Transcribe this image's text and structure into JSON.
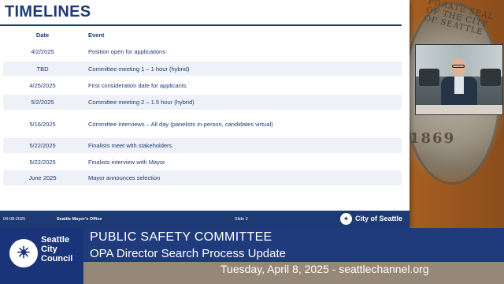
{
  "slide": {
    "title": "TIMELINES",
    "table": {
      "headers": [
        "Date",
        "Event"
      ],
      "rows": [
        {
          "date": "4/2/2025",
          "event": "Position open for applications"
        },
        {
          "date": "TBD",
          "event": "Committee meeting 1 – 1 hour (hybrid)"
        },
        {
          "date": "4/25/2025",
          "event": "First consideration date for applicants"
        },
        {
          "date": "5/2/2025",
          "event": "Committee meeting 2 – 1.5 hour (hybrid)"
        },
        {
          "date": "5/16/2025",
          "event": "Committee interviews – All day (panelists in-person, candidates virtual)"
        },
        {
          "date": "5/22/2025",
          "event": "Finalists meet with stakeholders"
        },
        {
          "date": "5/22/2025",
          "event": "Finalists interview with Mayor"
        },
        {
          "date": "June 2025",
          "event": "Mayor announces selection"
        }
      ]
    },
    "footer": {
      "date": "04-08-2025",
      "office": "Seattle Mayor’s Office",
      "slide_number": "Slide 2",
      "logo_text": "City of Seattle"
    }
  },
  "background": {
    "seal_text": "PORATE SEAL OF THE CITY OF SEATTLE",
    "seal_year": "1869"
  },
  "lower_third": {
    "council_name": "Seattle City Council",
    "title": "PUBLIC SAFETY COMMITTEE",
    "subtitle": "OPA Director Search Process Update",
    "date_line": "Tuesday, April 8, 2025 - seattlechannel.org"
  },
  "colors": {
    "brand_navy": "#1d3a75",
    "row_shade": "#eef1f8",
    "banner_blue": "#1f3b7c"
  }
}
